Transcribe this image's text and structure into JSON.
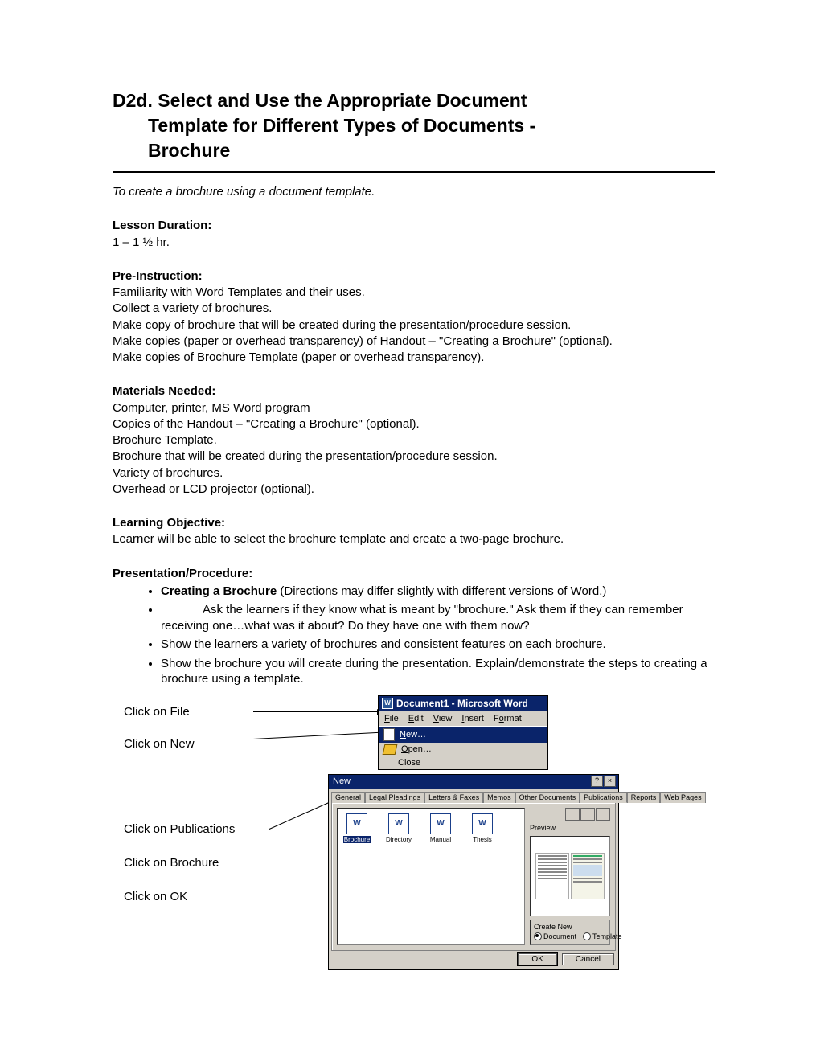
{
  "title_line1": "D2d.  Select and Use the Appropriate Document",
  "title_line2": "Template for Different Types of Documents -",
  "title_line3": "Brochure",
  "intro": "To create a brochure using a document template.",
  "lesson_duration_head": "Lesson Duration:",
  "lesson_duration_text": "1 – 1 ½ hr.",
  "preinstruction_head": "Pre-Instruction:",
  "preinstruction_lines": [
    "Familiarity with Word Templates and their uses.",
    "Collect a variety of brochures.",
    "Make copy of brochure that will be created during the presentation/procedure session.",
    "Make copies (paper or overhead transparency) of Handout – \"Creating a Brochure\" (optional).",
    "Make copies of Brochure Template (paper or overhead transparency)."
  ],
  "materials_head": "Materials Needed:",
  "materials_lines": [
    "Computer, printer, MS Word program",
    "Copies of the Handout – \"Creating a Brochure\" (optional).",
    "Brochure Template.",
    "Brochure that will be created during the presentation/procedure session.",
    "Variety of brochures.",
    "Overhead or LCD projector (optional)."
  ],
  "objective_head": "Learning Objective:",
  "objective_text": "Learner will be able to select the brochure template and create a two-page brochure.",
  "procedure_head": "Presentation/Procedure:",
  "procedure_items": [
    {
      "bold": "Creating a Brochure",
      "rest": " (Directions may differ slightly with different versions of Word.)"
    },
    {
      "rest": "Ask the learners if they know what is meant by \"brochure.\"  Ask them if they can remember receiving one…what was it about?  Do they have one with them now?"
    },
    {
      "rest": "Show the learners a variety of brochures and consistent features on each brochure."
    },
    {
      "rest": "Show the brochure you will create during the presentation.  Explain/demonstrate the steps to creating a brochure using a template."
    }
  ],
  "steps": {
    "file": "Click on File",
    "new": "Click on New",
    "publications": "Click on Publications",
    "brochure": "Click on Brochure",
    "ok": "Click on OK"
  },
  "word": {
    "title": "Document1 - Microsoft Word",
    "menus": [
      "File",
      "Edit",
      "View",
      "Insert",
      "Format"
    ],
    "menu_new": "New…",
    "menu_open": "Open…",
    "menu_close": "Close"
  },
  "dialog": {
    "title": "New",
    "tabs": [
      "General",
      "Legal Pleadings",
      "Letters & Faxes",
      "Memos",
      "Other Documents",
      "Publications",
      "Reports",
      "Web Pages"
    ],
    "active_tab": "Publications",
    "templates": [
      "Brochure",
      "Directory",
      "Manual",
      "Thesis"
    ],
    "selected_template": "Brochure",
    "preview_label": "Preview",
    "create_new_label": "Create New",
    "radio_document": "Document",
    "radio_template": "Template",
    "ok": "OK",
    "cancel": "Cancel"
  }
}
